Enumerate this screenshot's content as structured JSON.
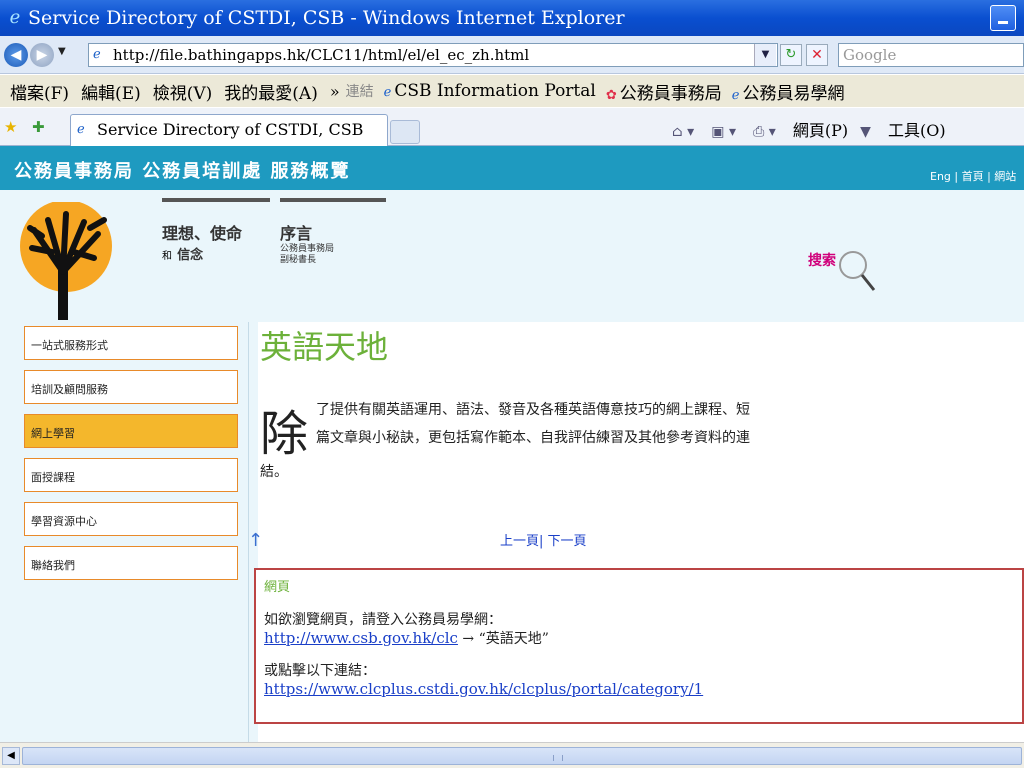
{
  "window": {
    "title": "Service Directory of CSTDI, CSB - Windows Internet Explorer"
  },
  "address": {
    "url": "http://file.bathingapps.hk/CLC11/html/el/el_ec_zh.html",
    "search_placeholder": "Google"
  },
  "menubar": {
    "items": [
      "檔案(F)",
      "編輯(E)",
      "檢視(V)",
      "我的最愛(A)"
    ],
    "chevron": "»",
    "links_label": "連結",
    "favorites": [
      "CSB Information Portal",
      "公務員事務局",
      "公務員易學網"
    ]
  },
  "tabbar": {
    "tab_title": "Service Directory of CSTDI, CSB",
    "page_menu": "網頁(P)",
    "tools_menu": "工具(O)"
  },
  "header": {
    "title": "公務員事務局 公務員培訓處 服務概覽",
    "links": "Eng | 首頁 | 網站"
  },
  "topnav": {
    "link1_line1": "理想、使命",
    "link1_line2_small": "和",
    "link1_line2": "信念",
    "link2_title": "序言",
    "link2_sub1": "公務員事務局",
    "link2_sub2": "副秘書長",
    "search_label": "搜索"
  },
  "sidebar": {
    "items": [
      {
        "label": "一站式服務形式",
        "active": false
      },
      {
        "label": "培訓及顧問服務",
        "active": false
      },
      {
        "label": "網上學習",
        "active": true
      },
      {
        "label": "面授課程",
        "active": false
      },
      {
        "label": "學習資源中心",
        "active": false
      },
      {
        "label": "聯絡我們",
        "active": false
      }
    ]
  },
  "content": {
    "heading": "英語天地",
    "dropcap": "除",
    "line1": "了提供有關英語運用、語法、發音及各種英語傳意技巧的網上課程、短",
    "line2": "篇文章與小秘訣，更包括寫作範本、自我評估練習及其他參考資料的連",
    "line3": "結。",
    "prev": "上一頁",
    "sep": "|",
    "next": "下一頁"
  },
  "notice": {
    "heading": "網頁",
    "text1": "如欲瀏覽網頁，請登入公務員易學網：",
    "link1": "http://www.csb.gov.hk/clc",
    "arrow_text": "→ “英語天地”",
    "text2": "或點擊以下連結：",
    "link2": "https://www.clcplus.cstdi.gov.hk/clcplus/portal/category/1"
  },
  "colors": {
    "header_bg": "#1e9ac0",
    "heading_green": "#6cb13a",
    "active_menu": "#f4b72c",
    "menu_border": "#e88a2a",
    "notice_border": "#bb4444"
  }
}
